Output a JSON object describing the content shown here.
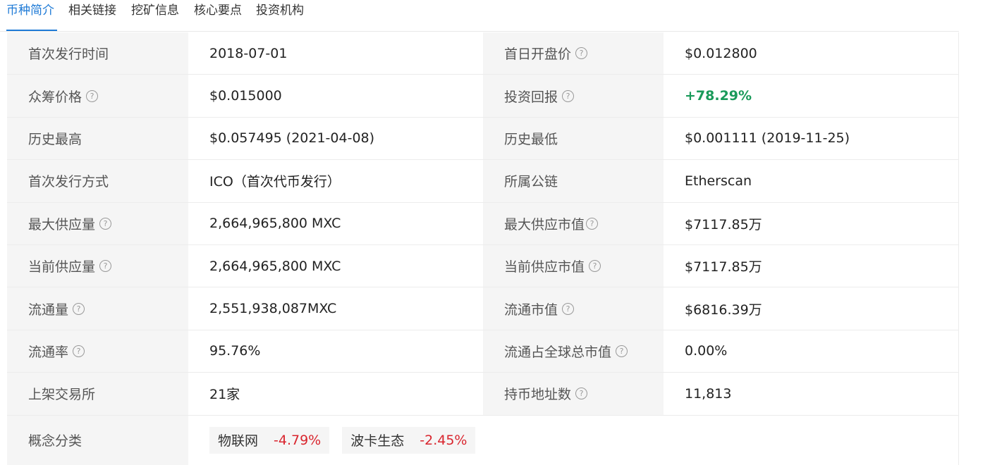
{
  "tabs": [
    {
      "label": "币种简介",
      "active": true
    },
    {
      "label": "相关链接",
      "active": false
    },
    {
      "label": "挖矿信息",
      "active": false
    },
    {
      "label": "核心要点",
      "active": false
    },
    {
      "label": "投资机构",
      "active": false
    }
  ],
  "rows": [
    {
      "label1": "首次发行时间",
      "help1": false,
      "value1": "2018-07-01",
      "label2": "首日开盘价",
      "help2": true,
      "value2": "$0.012800"
    },
    {
      "label1": "众筹价格",
      "help1": true,
      "value1": "$0.015000",
      "label2": "投资回报",
      "help2": true,
      "value2": "+78.29%"
    },
    {
      "label1": "历史最高",
      "help1": false,
      "value1": "$0.057495 (2021-04-08)",
      "label2": "历史最低",
      "help2": false,
      "value2": "$0.001111 (2019-11-25)"
    },
    {
      "label1": "首次发行方式",
      "help1": false,
      "value1": "ICO（首次代币发行）",
      "label2": "所属公链",
      "help2": false,
      "value2": "Etherscan"
    },
    {
      "label1": "最大供应量",
      "help1": true,
      "value1": "2,664,965,800 MXC",
      "label2": "最大供应市值",
      "help2": true,
      "value2": "$7117.85万"
    },
    {
      "label1": "当前供应量",
      "help1": true,
      "value1": "2,664,965,800 MXC",
      "label2": "当前供应市值",
      "help2": true,
      "value2": "$7117.85万"
    },
    {
      "label1": "流通量",
      "help1": true,
      "value1": "2,551,938,087MXC",
      "label2": "流通市值",
      "help2": true,
      "value2": "$6816.39万"
    },
    {
      "label1": "流通率",
      "help1": true,
      "value1": "95.76%",
      "label2": "流通占全球总市值",
      "help2": true,
      "value2": "0.00%"
    },
    {
      "label1": "上架交易所",
      "help1": false,
      "value1": "21家",
      "label2": "持币地址数",
      "help2": true,
      "value2": "11,813"
    }
  ],
  "concept": {
    "label": "概念分类",
    "tags": [
      {
        "name": "物联网",
        "change": "-4.79%"
      },
      {
        "name": "波卡生态",
        "change": "-2.45%"
      }
    ]
  },
  "help_glyph": "?",
  "colors": {
    "accent": "#1e7ad6",
    "positive": "#1a9a5a",
    "negative": "#d9252e",
    "label_bg": "#f5f5f5"
  }
}
